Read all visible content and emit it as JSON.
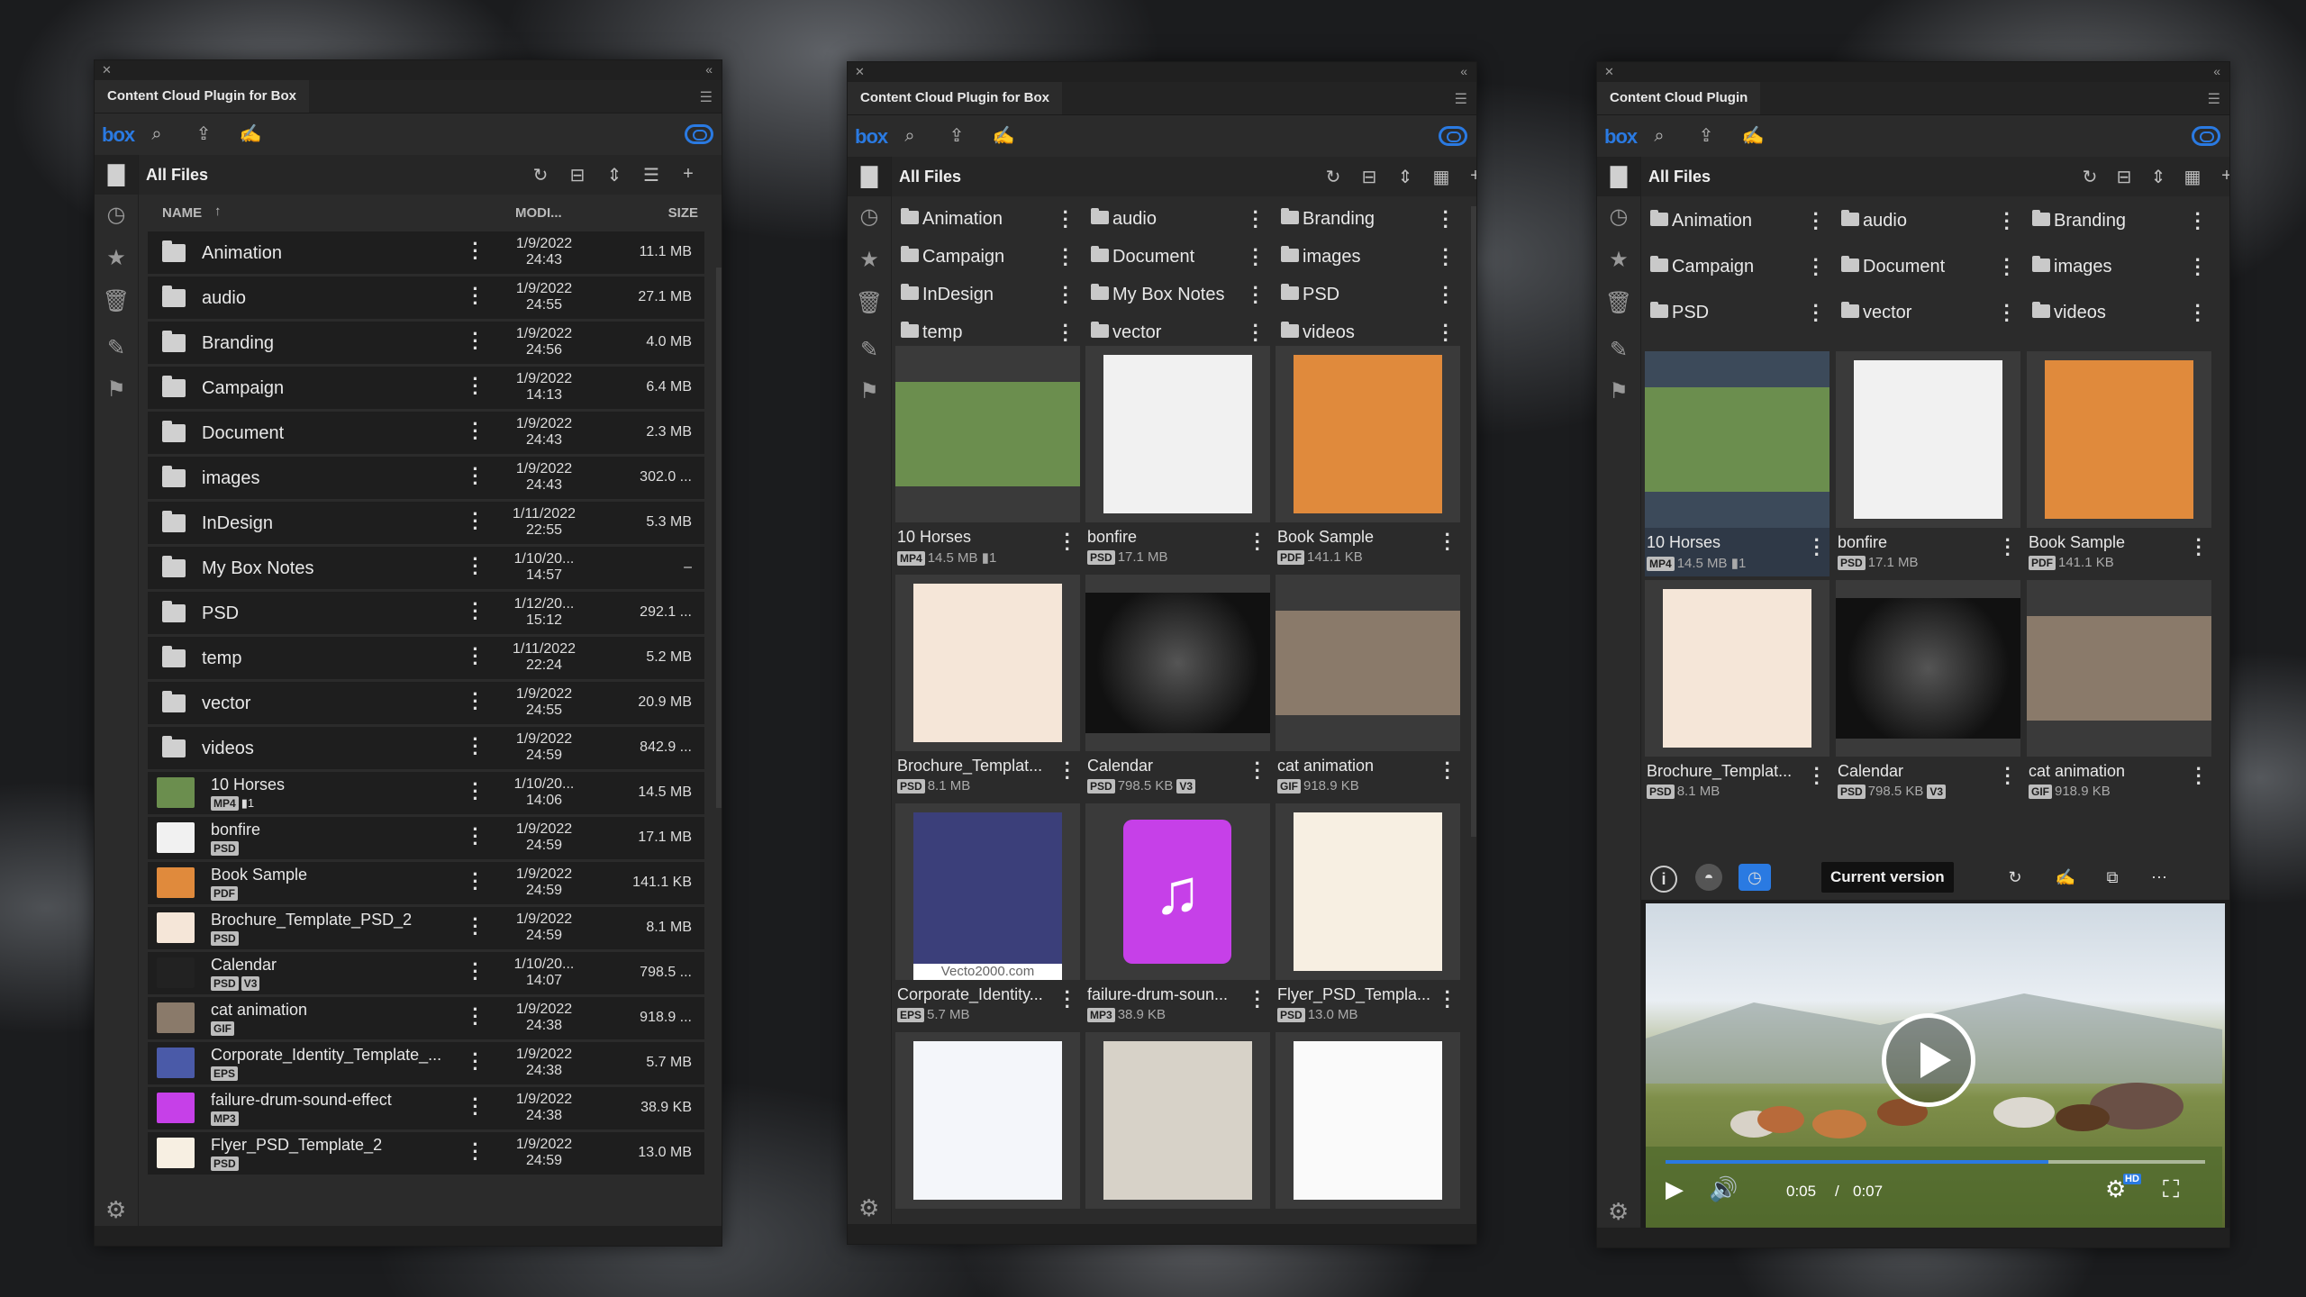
{
  "panel1": {
    "tab": "Content Cloud Plugin for Box",
    "header_title": "All Files",
    "columns": {
      "name": "NAME",
      "sort_icon": "↑",
      "modified": "MODI...",
      "size": "SIZE"
    },
    "folders": [
      {
        "name": "Animation",
        "date": "1/9/2022",
        "time": "24:43",
        "size": "11.1 MB"
      },
      {
        "name": "audio",
        "date": "1/9/2022",
        "time": "24:55",
        "size": "27.1 MB"
      },
      {
        "name": "Branding",
        "date": "1/9/2022",
        "time": "24:56",
        "size": "4.0 MB"
      },
      {
        "name": "Campaign",
        "date": "1/9/2022",
        "time": "14:13",
        "size": "6.4 MB"
      },
      {
        "name": "Document",
        "date": "1/9/2022",
        "time": "24:43",
        "size": "2.3 MB"
      },
      {
        "name": "images",
        "date": "1/9/2022",
        "time": "24:43",
        "size": "302.0 ..."
      },
      {
        "name": "InDesign",
        "date": "1/11/2022",
        "time": "22:55",
        "size": "5.3 MB"
      },
      {
        "name": "My Box Notes",
        "date": "1/10/20...",
        "time": "14:57",
        "size": "–"
      },
      {
        "name": "PSD",
        "date": "1/12/20...",
        "time": "15:12",
        "size": "292.1 ..."
      },
      {
        "name": "temp",
        "date": "1/11/2022",
        "time": "22:24",
        "size": "5.2 MB"
      },
      {
        "name": "vector",
        "date": "1/9/2022",
        "time": "24:55",
        "size": "20.9 MB"
      },
      {
        "name": "videos",
        "date": "1/9/2022",
        "time": "24:59",
        "size": "842.9 ..."
      }
    ],
    "files": [
      {
        "name": "10 Horses",
        "type": "MP4",
        "comments": "1",
        "date": "1/10/20...",
        "time": "14:06",
        "size": "14.5 MB",
        "thumb": "#6b8e4e"
      },
      {
        "name": "bonfire",
        "type": "PSD",
        "date": "1/9/2022",
        "time": "24:59",
        "size": "17.1 MB",
        "thumb": "#f1f1f1"
      },
      {
        "name": "Book Sample",
        "type": "PDF",
        "date": "1/9/2022",
        "time": "24:59",
        "size": "141.1 KB",
        "thumb": "#e08a3c"
      },
      {
        "name": "Brochure_Template_PSD_2",
        "type": "PSD",
        "date": "1/9/2022",
        "time": "24:59",
        "size": "8.1 MB",
        "thumb": "#f5e6d8"
      },
      {
        "name": "Calendar",
        "type": "PSD",
        "version": "V3",
        "date": "1/10/20...",
        "time": "14:07",
        "size": "798.5 ...",
        "thumb": "#222222"
      },
      {
        "name": "cat animation",
        "type": "GIF",
        "date": "1/9/2022",
        "time": "24:38",
        "size": "918.9 ...",
        "thumb": "#8a7a6a"
      },
      {
        "name": "Corporate_Identity_Template_...",
        "type": "EPS",
        "date": "1/9/2022",
        "time": "24:38",
        "size": "5.7 MB",
        "thumb": "#4a5aa8"
      },
      {
        "name": "failure-drum-sound-effect",
        "type": "MP3",
        "date": "1/9/2022",
        "time": "24:38",
        "size": "38.9 KB",
        "thumb": "#c640e8"
      },
      {
        "name": "Flyer_PSD_Template_2",
        "type": "PSD",
        "date": "1/9/2022",
        "time": "24:59",
        "size": "13.0 MB",
        "thumb": "#f7efe2"
      }
    ]
  },
  "panel2": {
    "tab": "Content Cloud Plugin for Box",
    "header_title": "All Files",
    "folders": [
      "Animation",
      "audio",
      "Branding",
      "Campaign",
      "Document",
      "images",
      "InDesign",
      "My Box Notes",
      "PSD",
      "temp",
      "vector",
      "videos"
    ],
    "cards": [
      {
        "name": "10 Horses",
        "type": "MP4",
        "size": "14.5 MB",
        "comments": "1",
        "bg": "#6b8e4e"
      },
      {
        "name": "bonfire",
        "type": "PSD",
        "size": "17.1 MB",
        "bg": "#f1f1f1"
      },
      {
        "name": "Book Sample",
        "type": "PDF",
        "size": "141.1 KB",
        "bg": "#e08a3c"
      },
      {
        "name": "Brochure_Templat...",
        "type": "PSD",
        "size": "8.1 MB",
        "bg": "#f5e6d8"
      },
      {
        "name": "Calendar",
        "type": "PSD",
        "size": "798.5 KB",
        "version": "V3",
        "bg": "#1a1a1a"
      },
      {
        "name": "cat animation",
        "type": "GIF",
        "size": "918.9 KB",
        "bg": "#8a7a6a"
      },
      {
        "name": "Corporate_Identity...",
        "type": "EPS",
        "size": "5.7 MB",
        "bg": "#3b3f7a",
        "caption": "Vecto2000.com"
      },
      {
        "name": "failure-drum-soun...",
        "type": "MP3",
        "size": "38.9 KB",
        "bg": "#2b2b2b"
      },
      {
        "name": "Flyer_PSD_Templa...",
        "type": "PSD",
        "size": "13.0 MB",
        "bg": "#f7efe2"
      },
      {
        "name": "",
        "type": "",
        "size": "",
        "bg": "#f4f6fa"
      },
      {
        "name": "",
        "type": "",
        "size": "",
        "bg": "#d7d2c8"
      },
      {
        "name": "",
        "type": "",
        "size": "",
        "bg": "#fafafa"
      }
    ]
  },
  "panel3": {
    "tab": "Content Cloud Plugin",
    "header_title": "All Files",
    "folders": [
      "Animation",
      "audio",
      "Branding",
      "Campaign",
      "Document",
      "images",
      "PSD",
      "vector",
      "videos"
    ],
    "cards": [
      {
        "name": "10 Horses",
        "type": "MP4",
        "size": "14.5 MB",
        "comments": "1",
        "bg": "#6b8e4e"
      },
      {
        "name": "bonfire",
        "type": "PSD",
        "size": "17.1 MB",
        "bg": "#f1f1f1"
      },
      {
        "name": "Book Sample",
        "type": "PDF",
        "size": "141.1 KB",
        "bg": "#e08a3c"
      },
      {
        "name": "Brochure_Templat...",
        "type": "PSD",
        "size": "8.1 MB",
        "bg": "#f5e6d8"
      },
      {
        "name": "Calendar",
        "type": "PSD",
        "size": "798.5 KB",
        "version": "V3",
        "bg": "#1a1a1a"
      },
      {
        "name": "cat animation",
        "type": "GIF",
        "size": "918.9 KB",
        "bg": "#8a7a6a"
      }
    ],
    "detail": {
      "version_label": "Current version",
      "current_time": "0:05",
      "separator": "/",
      "duration": "0:07",
      "progress": 0.71,
      "hd_badge": "HD"
    }
  },
  "colors": {
    "accent": "#2a7ae2",
    "panel": "#2b2b2b",
    "row": "#1e1e1e"
  },
  "icons": [
    "box-logo",
    "search-icon",
    "upload-icon",
    "sign-icon",
    "cloud-sync-icon",
    "folder-icon",
    "recent-icon",
    "star-icon",
    "trash-icon",
    "annotate-icon",
    "flag-icon",
    "refresh-icon",
    "layout-icon",
    "sort-icon",
    "list-view-icon",
    "grid-view-icon",
    "plus-icon",
    "settings-gear-icon",
    "more-vertical-icon"
  ]
}
